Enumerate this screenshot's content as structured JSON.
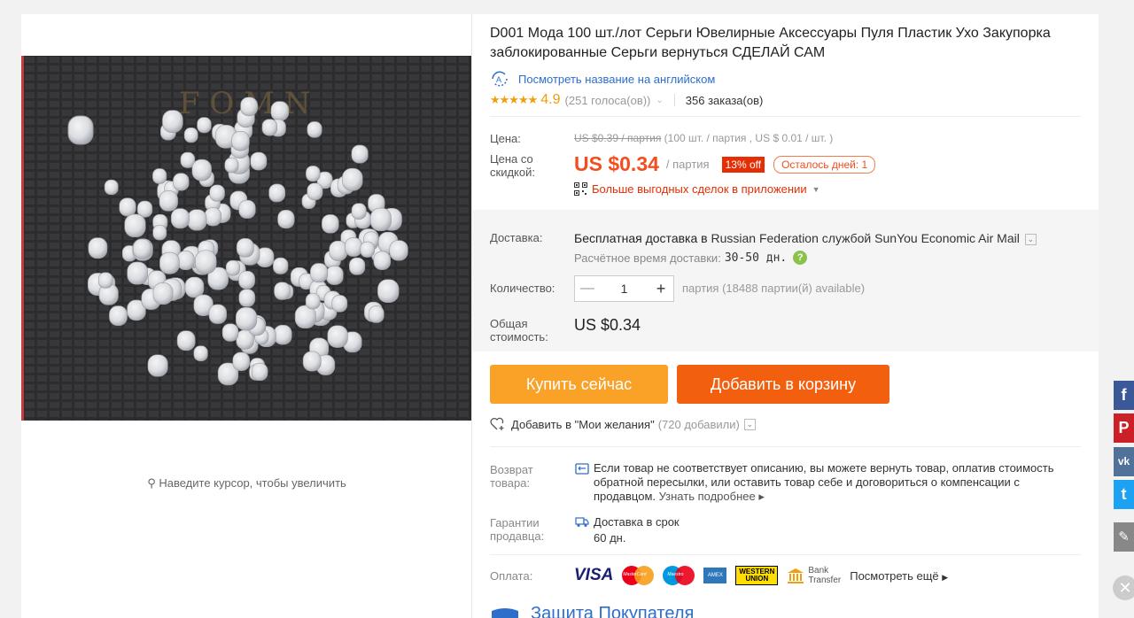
{
  "product": {
    "title": "D001 Мода 100 шт./лот Серьги Ювелирные Аксессуары Пуля Пластик Ухо Закупорка заблокированные Серьги вернуться СДЕЛАЙ САМ",
    "translate_link": "Посмотреть название на английском",
    "image_background_text": "F O M N",
    "zoom_hint": "Наведите курсор, чтобы увеличить"
  },
  "rating": {
    "stars": "★★★★★",
    "score": "4.9",
    "votes": "(251 голоса(ов))",
    "orders": "356 заказа(ов)"
  },
  "price": {
    "label": "Цена:",
    "old_price": "US $0.39 / партия",
    "unit_note": "(100 шт. / партия , US $ 0.01 / шт. )",
    "discount_label_1": "Цена со",
    "discount_label_2": "скидкой:",
    "current": "US $0.34",
    "per": "/ партия",
    "off_badge": "13% off",
    "days_left": "Осталось дней: 1",
    "app_deals": "Больше выгодных сделок в приложении"
  },
  "shipping": {
    "label": "Доставка:",
    "free": "Бесплатная доставка в",
    "country": "Russian Federation",
    "service_prefix": "службой",
    "service": "SunYou Economic Air Mail",
    "eta_label": "Расчётное время доставки:",
    "eta_value": "30-50 дн."
  },
  "quantity": {
    "label": "Количество:",
    "value": "1",
    "note": "партия (18488 партии(й) available)"
  },
  "total": {
    "label_1": "Общая",
    "label_2": "стоимость:",
    "value": "US $0.34"
  },
  "buttons": {
    "buy_now": "Купить сейчас",
    "add_to_cart": "Добавить в корзину"
  },
  "wishlist": {
    "label": "Добавить в \"Мои желания\"",
    "count": "(720 добавили)"
  },
  "returns": {
    "label_1": "Возврат",
    "label_2": "товара:",
    "text": "Если товар не соответствует описанию, вы можете вернуть товар, оплатив стоимость обратной пересылки, или оставить товар себе и договориться о компенсации с продавцом.",
    "more": "Узнать подробнее"
  },
  "guarantee": {
    "label_1": "Гарантии",
    "label_2": "продавца:",
    "line1": "Доставка в срок",
    "line2": "60 дн."
  },
  "payment": {
    "label": "Оплата:",
    "visa": "VISA",
    "mastercard": "MasterCard",
    "maestro": "Maestro",
    "amex": "AMEX",
    "wu_1": "WESTERN",
    "wu_2": "UNION",
    "bank_1": "Bank",
    "bank_2": "Transfer",
    "see_more": "Посмотреть ещё"
  },
  "protection": {
    "title": "Защита Покупателя"
  },
  "social": {
    "facebook": "f",
    "pinterest": "P",
    "vk": "vk",
    "twitter": "t"
  },
  "colors": {
    "price_orange": "#f24e1e",
    "buy_button": "#faa228",
    "cart_button": "#f2600f",
    "link_blue": "#2d6ecb",
    "star_gold": "#f49c0b"
  }
}
